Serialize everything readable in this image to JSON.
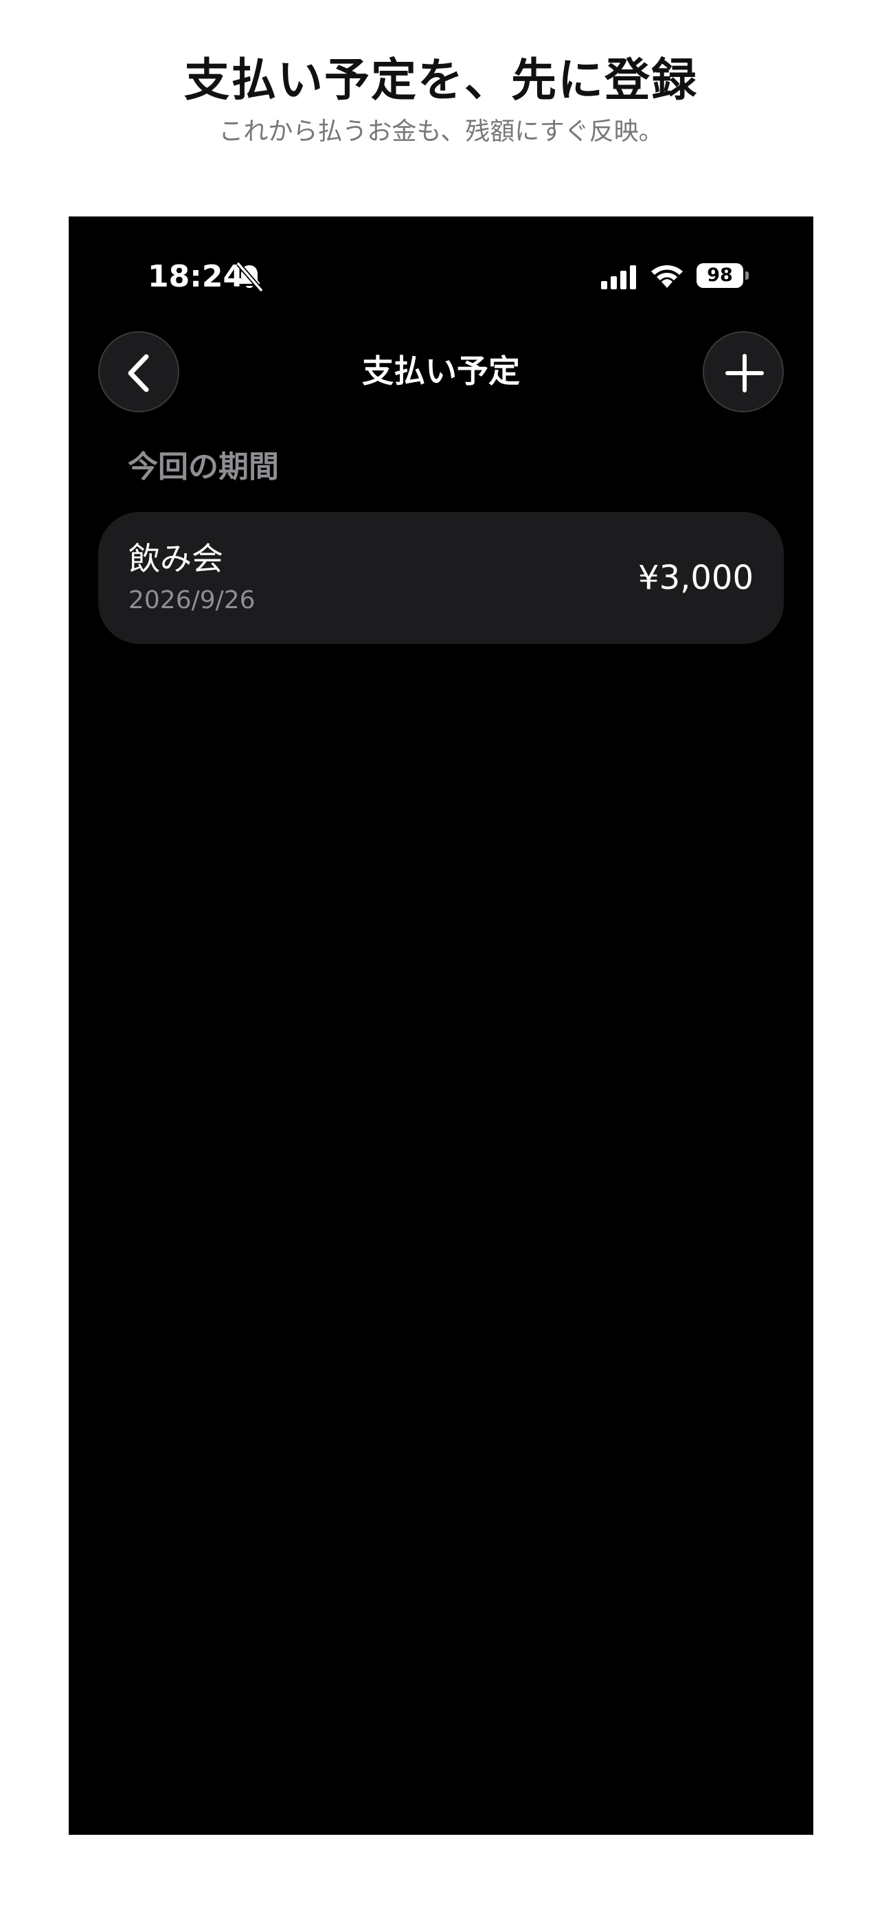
{
  "promo": {
    "title": "支払い予定を、先に登録",
    "subtitle": "これから払うお金も、残額にすぐ反映。"
  },
  "status_bar": {
    "time": "18:24",
    "battery_level": "98",
    "icons": [
      "bell-slash-icon",
      "cellular-signal-icon",
      "wifi-icon",
      "battery-icon"
    ]
  },
  "nav": {
    "title": "支払い予定",
    "back_icon": "chevron-left-icon",
    "add_icon": "plus-icon"
  },
  "section": {
    "label": "今回の期間"
  },
  "payments": [
    {
      "name": "飲み会",
      "date": "2026/9/26",
      "amount": "¥3,000"
    }
  ],
  "colors": {
    "background": "#000000",
    "card": "#1c1c1e",
    "secondary_text": "#8e8e93",
    "primary_text": "#ffffff"
  }
}
